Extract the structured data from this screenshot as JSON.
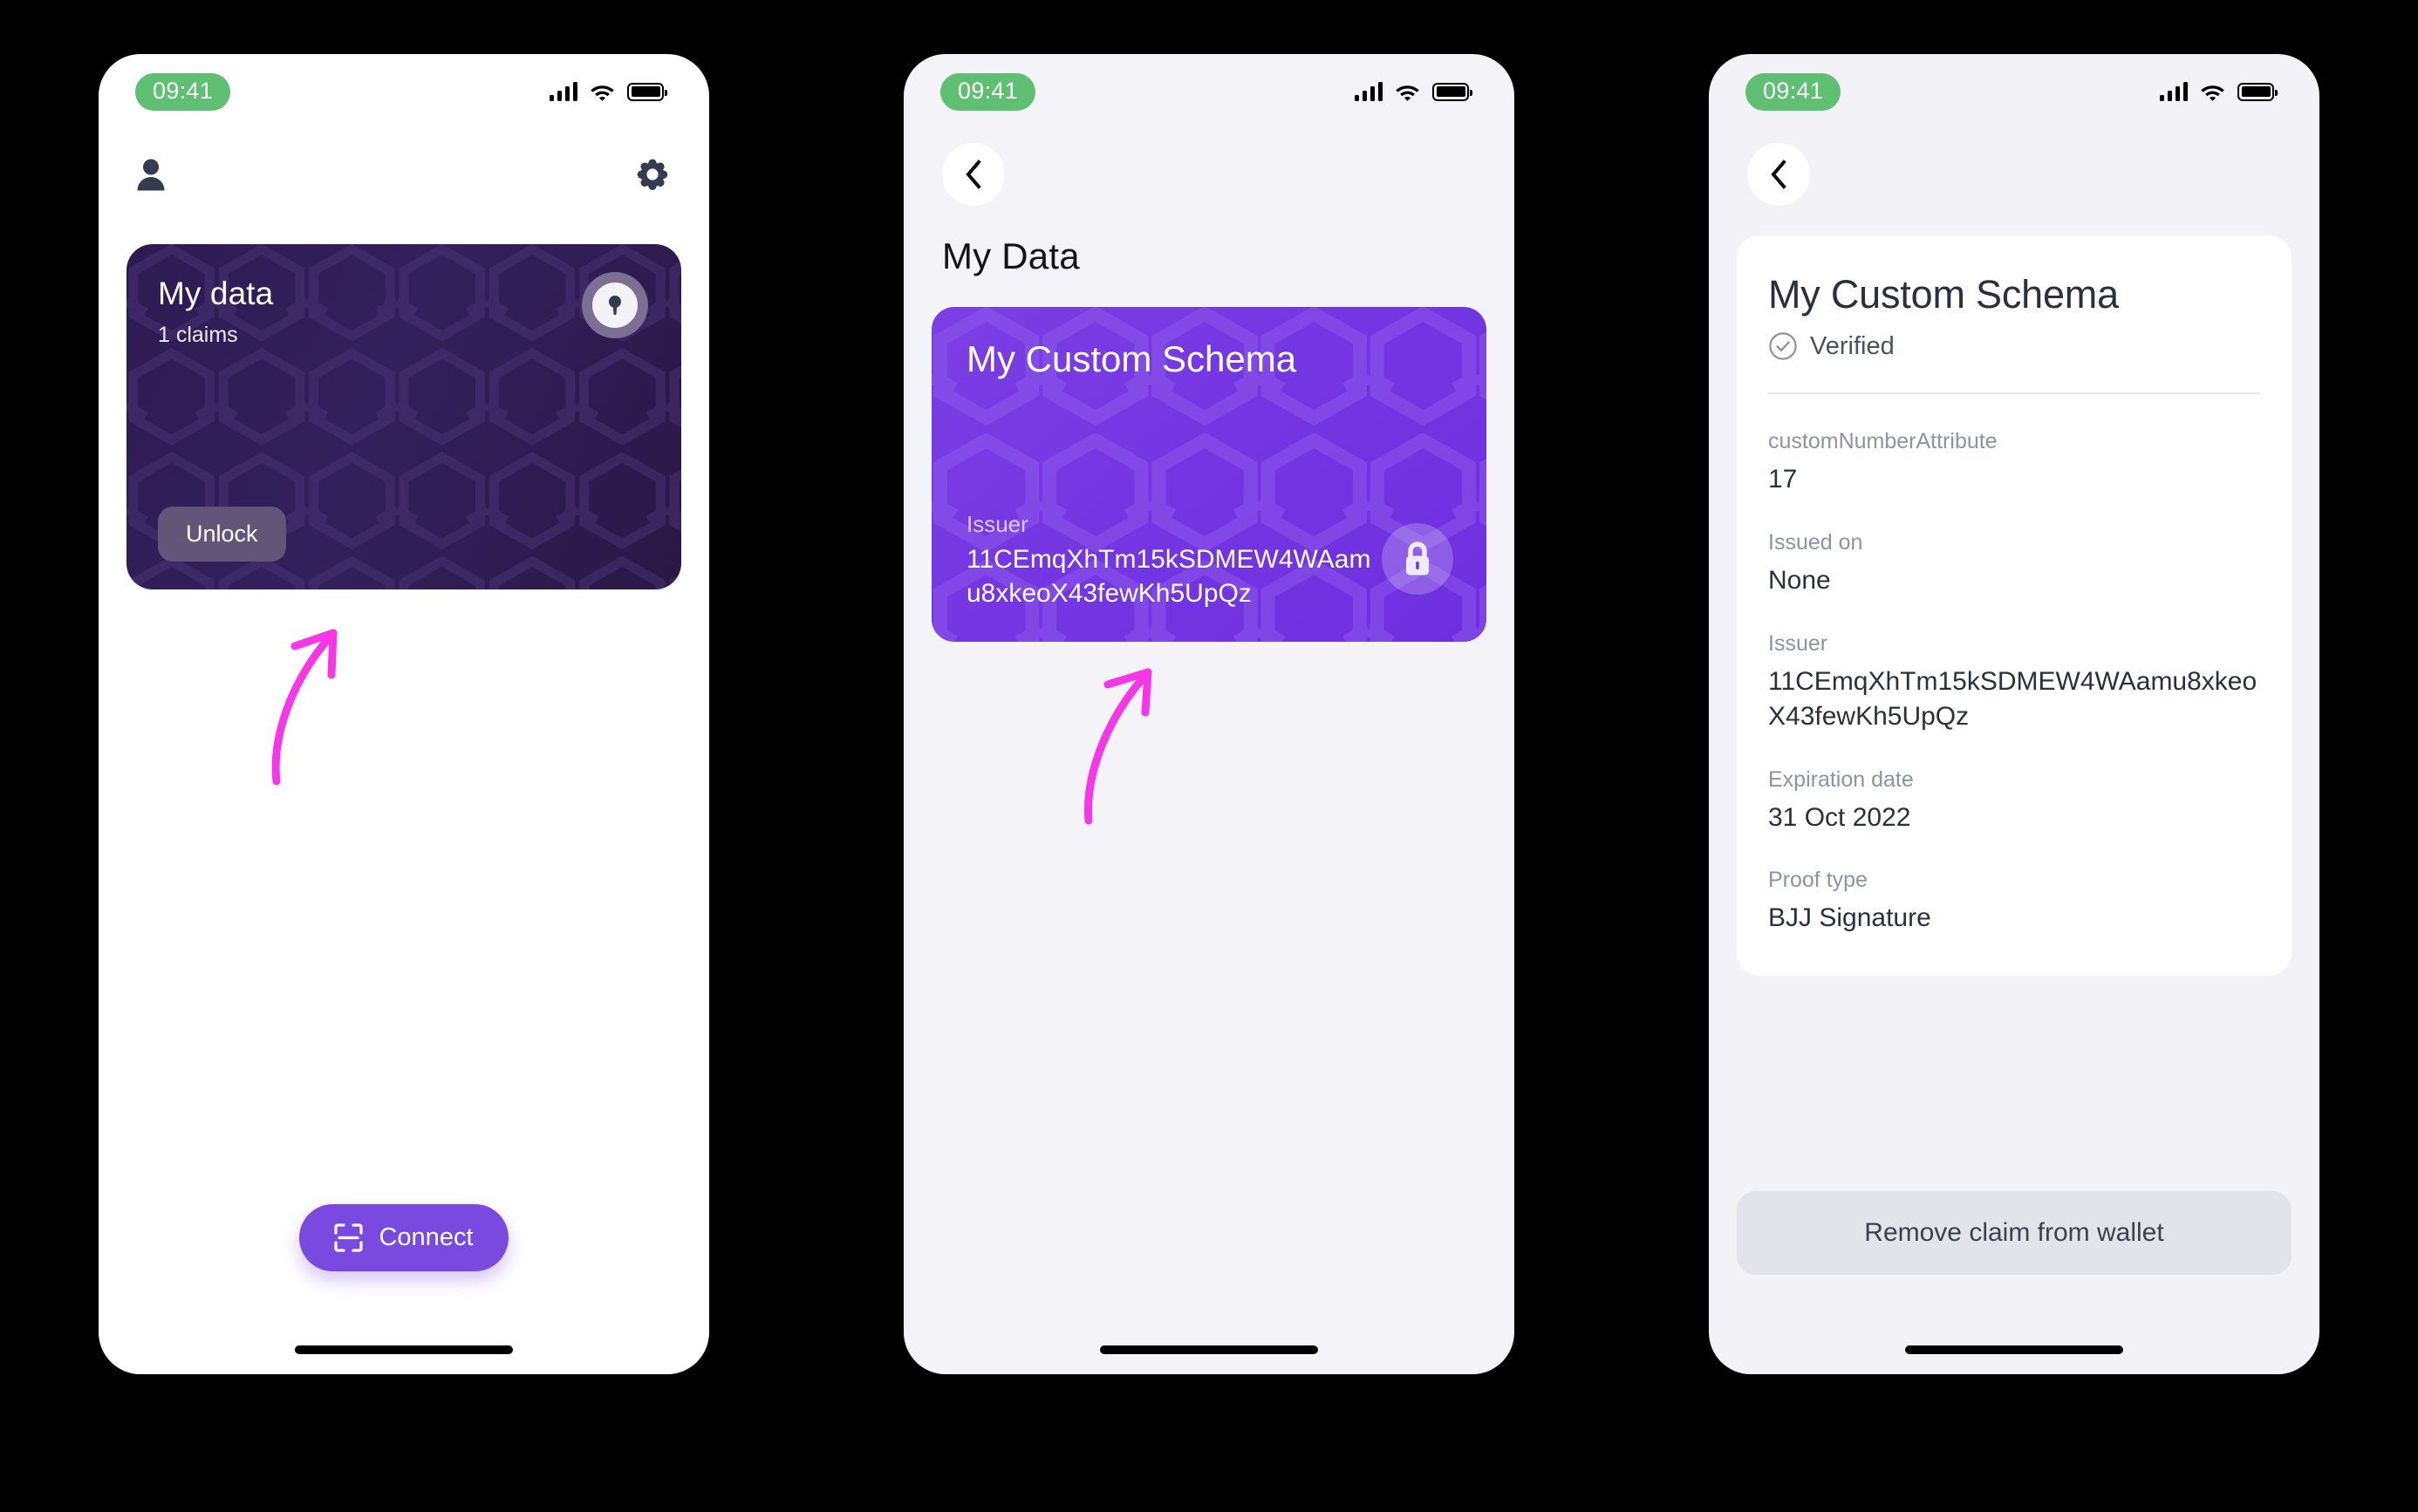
{
  "status_bar": {
    "time": "09:41",
    "time_badge_color": "#5FBF72",
    "icons": [
      "signal-icon",
      "wifi-icon",
      "battery-icon"
    ]
  },
  "annotations": {
    "arrow_color": "#F736E8",
    "arrows": [
      {
        "name": "arrow-pointing-to-my-data-card",
        "screen": 1
      },
      {
        "name": "arrow-pointing-to-schema-card",
        "screen": 2
      }
    ]
  },
  "screen1": {
    "name": "wallet-home",
    "background": "#FFFFFF",
    "toolbar": {
      "profile_icon": "person-icon",
      "settings_icon": "gear-icon"
    },
    "card": {
      "title": "My data",
      "subtitle": "1 claims",
      "badge_icon": "keyhole-icon",
      "unlock_label": "Unlock",
      "gradient_from": "#2E1B53",
      "gradient_to": "#2A1846",
      "unlock_bg": "#635578"
    },
    "connect_button": {
      "label": "Connect",
      "icon": "scan-qr-icon",
      "color": "#7A49E0"
    }
  },
  "screen2": {
    "name": "my-data-list",
    "background": "#F4F4F8",
    "back_icon": "chevron-left-icon",
    "title": "My Data",
    "card": {
      "title": "My Custom Schema",
      "issuer_label": "Issuer",
      "issuer_value": "11CEmqXhTm15kSDMEW4WAamu8xkeoX43fewKh5UpQz",
      "lock_icon": "lock-icon",
      "gradient_from": "#7B3FE4",
      "gradient_to": "#6E2FDF"
    }
  },
  "screen3": {
    "name": "claim-detail",
    "background": "#F2F2F7",
    "back_icon": "chevron-left-icon",
    "title": "My Custom Schema",
    "verified": {
      "icon": "check-circle-icon",
      "label": "Verified"
    },
    "fields": [
      {
        "label": "customNumberAttribute",
        "value": "17"
      },
      {
        "label": "Issued on",
        "value": "None"
      },
      {
        "label": "Issuer",
        "value": "11CEmqXhTm15kSDMEW4WAamu8xkeoX43fewKh5UpQz"
      },
      {
        "label": "Expiration date",
        "value": "31 Oct 2022"
      },
      {
        "label": "Proof type",
        "value": "BJJ Signature"
      }
    ],
    "remove_button": {
      "label": "Remove claim from wallet",
      "bg": "#E3E4EA"
    }
  }
}
